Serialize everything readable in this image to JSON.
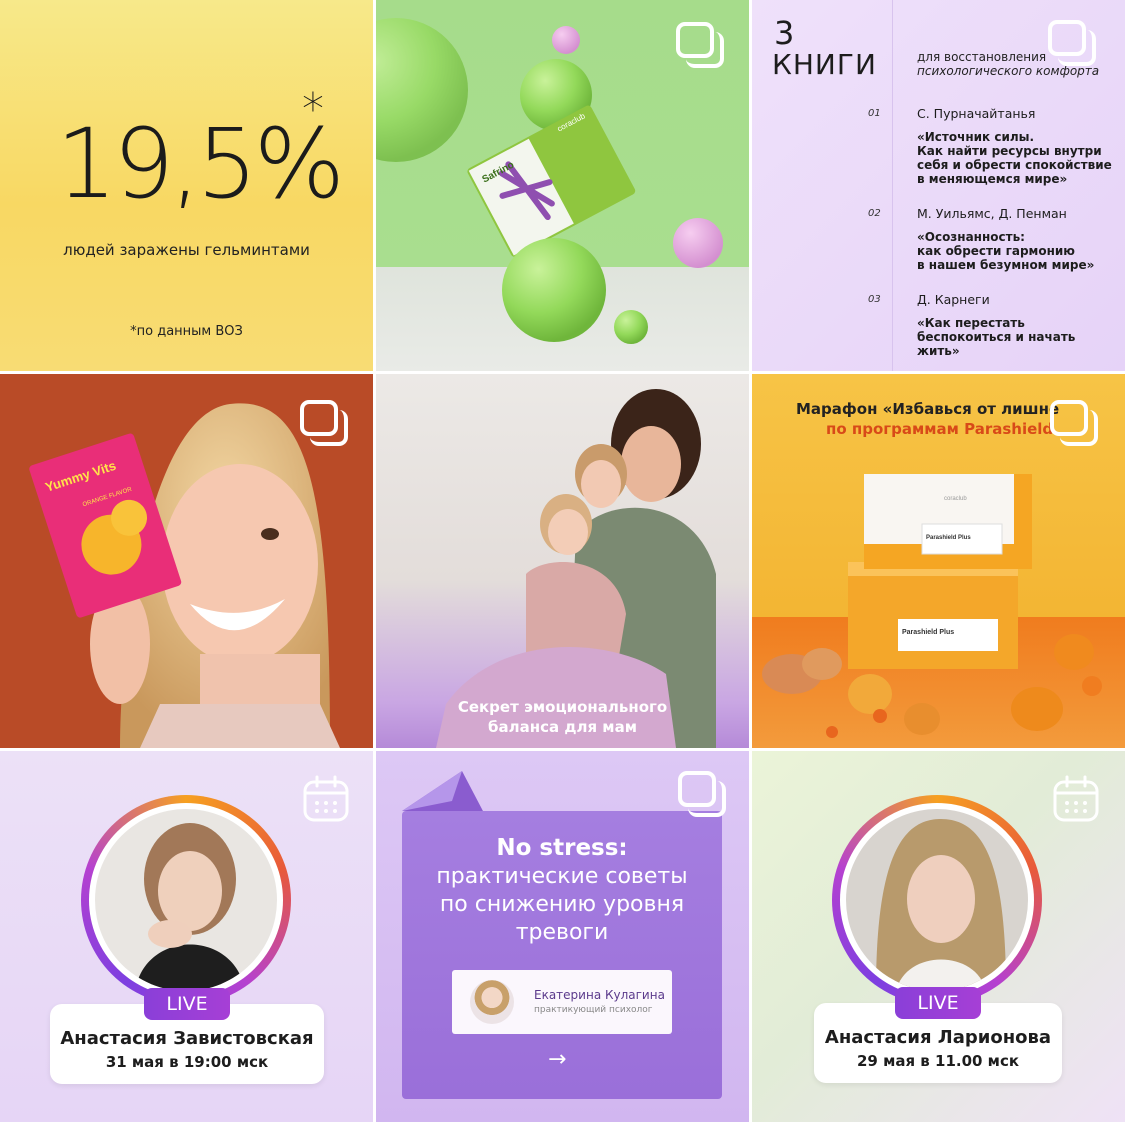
{
  "tile1": {
    "value": "19,5%",
    "asterisk": "*",
    "caption": "людей заражены гельминтами",
    "source": "*по данным ВОЗ"
  },
  "tile2": {
    "brand": "coraclub",
    "product": "Safrino"
  },
  "tile3": {
    "number": "3",
    "word": "КНИГИ",
    "subtitle_line1": "для восстановления",
    "subtitle_line2": "психологического комфорта",
    "books": [
      {
        "n": "01",
        "author": "С. Пурначайтанья",
        "title_lines": [
          "«Источник силы.",
          "Как найти ресурсы внутри",
          "себя и обрести спокойствие",
          "в меняющемся мире»"
        ]
      },
      {
        "n": "02",
        "author": "М. Уильямс, Д. Пенман",
        "title_lines": [
          "«Осознанность:",
          "как обрести гармонию",
          "в нашем безумном мире»"
        ]
      },
      {
        "n": "03",
        "author": "Д. Карнеги",
        "title_lines": [
          "«Как перестать",
          "беспокоиться и начать жить»"
        ]
      }
    ]
  },
  "tile4": {
    "product_brand": "Yummy Vits",
    "product_flavor": "ORANGE FLAVOR"
  },
  "tile5": {
    "caption_line1": "Секрет эмоционального",
    "caption_line2": "баланса для мам"
  },
  "tile6": {
    "title_line1": "Марафон «Избавься от лишне",
    "title_line2": "по программам Parashield",
    "box_brand": "coraclub",
    "box_label": "Parashield Plus"
  },
  "tile7": {
    "live": "LIVE",
    "name": "Анастасия Завистовская",
    "date": "31 мая в 19:00 мск"
  },
  "tile8": {
    "title": "No stress:",
    "subtitle_line1": "практические советы",
    "subtitle_line2": "по снижению уровня",
    "subtitle_line3": "тревоги",
    "speaker_name": "Екатерина Кулагина",
    "speaker_role": "практикующий психолог",
    "arrow": "→"
  },
  "tile9": {
    "live": "LIVE",
    "name": "Анастасия Ларионова",
    "date": "29 мая в 11.00 мск"
  }
}
